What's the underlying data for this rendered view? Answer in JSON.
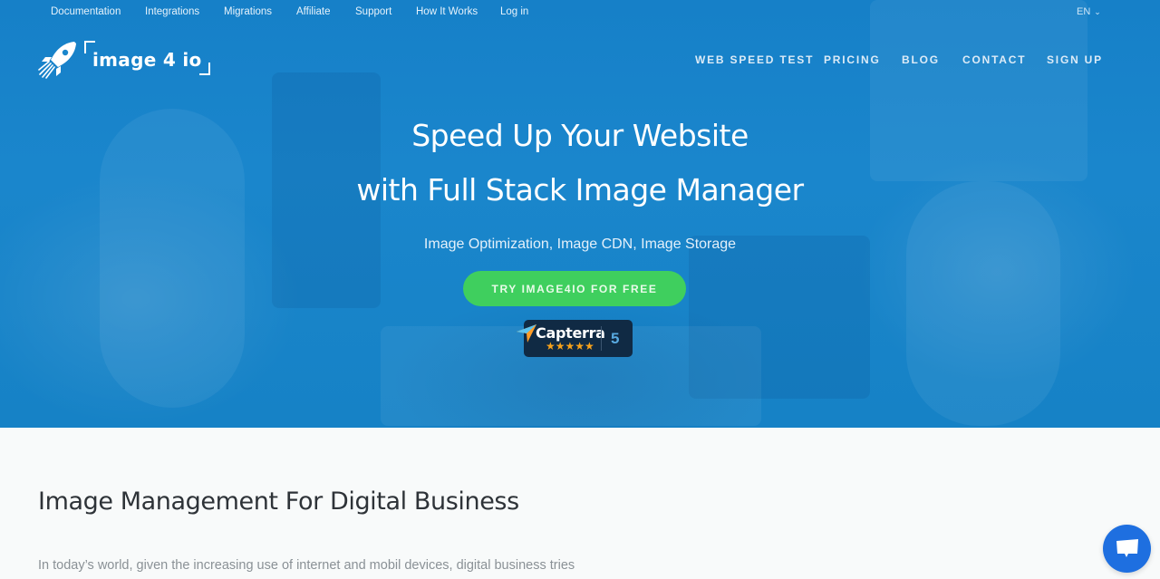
{
  "topbar": {
    "links": [
      "Documentation",
      "Integrations",
      "Migrations",
      "Affiliate",
      "Support",
      "How It Works",
      "Log in"
    ],
    "language": "EN"
  },
  "logo": {
    "text": "image 4 io",
    "icon": "rocket-icon"
  },
  "mainnav": {
    "items": [
      "WEB SPEED TEST",
      "PRICING",
      "BLOG",
      "CONTACT",
      "SIGN UP"
    ]
  },
  "hero": {
    "title_line1": "Speed Up Your Website",
    "title_line2": "with Full Stack Image Manager",
    "subtitle": "Image Optimization, Image CDN, Image Storage",
    "cta_label": "TRY IMAGE4IO FOR FREE",
    "capterra": {
      "name": "Capterra",
      "stars": "★★★★★",
      "rating": "5"
    }
  },
  "section": {
    "title": "Image Management For Digital Business",
    "text": "In today’s world, given the increasing use of internet and mobil devices, digital business tries"
  },
  "chat": {
    "icon": "chat-bubble-icon"
  },
  "colors": {
    "hero_blue": "#1a86cc",
    "cta_green": "#3fcf5e",
    "capterra_bg": "#102a44",
    "star_orange": "#f7a21b",
    "chat_blue": "#1e6fe0"
  }
}
